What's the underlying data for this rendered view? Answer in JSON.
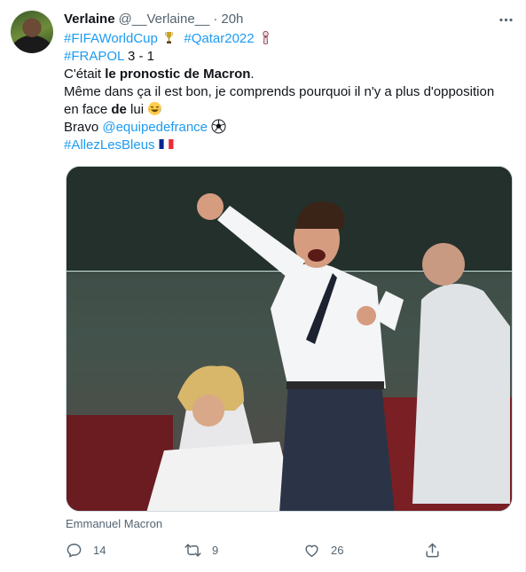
{
  "user": {
    "name": "Verlaine",
    "handle": "@__Verlaine__",
    "separator": "·",
    "time": "20h"
  },
  "tweet": {
    "hashtag_fifa": "#FIFAWorldCup",
    "hashtag_qatar": "#Qatar2022",
    "hashtag_frapol": "#FRAPOL",
    "score": " 3 - 1",
    "line3_prefix": "C'était ",
    "line3_bold": "le pronostic de Macron",
    "line3_suffix": ".",
    "line4_part1": "Même dans ça il est bon, je comprends pourquoi il n'y a plus d'opposition",
    "line5_prefix": "en face ",
    "line5_bold": "de",
    "line5_suffix": " lui ",
    "bravo": "Bravo ",
    "mention": "@equipedefrance",
    "hashtag_bleus": "#AllezLesBleus"
  },
  "media": {
    "caption": "Emmanuel Macron"
  },
  "actions": {
    "reply_count": "14",
    "retweet_count": "9",
    "like_count": "26"
  },
  "icons": {
    "more": "more-icon",
    "reply": "reply-icon",
    "retweet": "retweet-icon",
    "like": "like-icon",
    "share": "share-icon",
    "trophy": "trophy-icon",
    "pendant": "pendant-icon",
    "laugh": "laughing-emoji-icon",
    "ball": "soccer-ball-icon",
    "flag": "france-flag-icon"
  },
  "colors": {
    "link": "#1d9bf0",
    "muted": "#536471",
    "text": "#0f1419"
  }
}
